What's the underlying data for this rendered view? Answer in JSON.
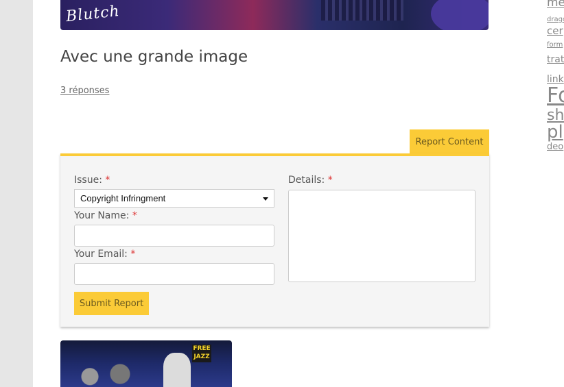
{
  "post": {
    "banner_signature": "Blutch",
    "title": "Avec une grande image",
    "replies_link": "3 réponses"
  },
  "report": {
    "tab_label": "Report Content",
    "issue_label": "Issue:",
    "issue_value": "Copyright Infringment",
    "name_label": "Your Name:",
    "name_value": "",
    "email_label": "Your Email:",
    "email_value": "",
    "details_label": "Details:",
    "details_value": "",
    "required_mark": "*",
    "submit_label": "Submit Report"
  },
  "thumbnail": {
    "sign_text": "FREE JAZZ"
  },
  "tag_cloud": [
    "me",
    "drago",
    "cer",
    "form",
    "trat",
    "link",
    "Fo",
    "sh",
    "pl",
    "deo"
  ],
  "colors": {
    "accent": "#fbcb37",
    "required": "#dd3333",
    "panel_bg": "#f5f5f5",
    "page_bg": "#e6e6e6"
  }
}
